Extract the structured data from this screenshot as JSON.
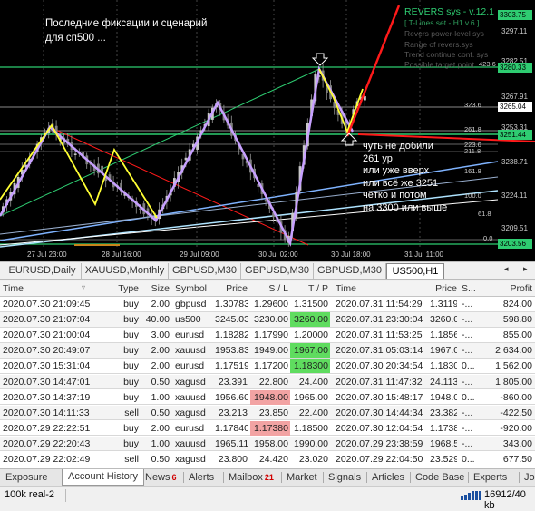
{
  "chart": {
    "annotation_title": "Последние фиксации и сценарий\nдля сп500 ...",
    "annotation_note": "чуть не добили\n261 ур\nили уже вверх\nили всё же 3251\nчётко и потом\nна 3300 или выше",
    "indicator": {
      "title": "REVERS sys - v.12.1",
      "lines": [
        "[ T-Lines set - H1 v.6 ]",
        "Revers power-level sys",
        "Range of revers.sys",
        "Trend continue conf. sys",
        "Possible target point"
      ]
    },
    "price_boxes": [
      {
        "value": "3303.75",
        "color": "#2ecc71"
      },
      {
        "value": "3280.33",
        "color": "#2ecc71"
      },
      {
        "value": "3265.04",
        "color": "#ffffff"
      },
      {
        "value": "3251.44",
        "color": "#2ecc71"
      },
      {
        "value": "3203.56",
        "color": "#2ecc71"
      }
    ],
    "price_axis": [
      "3297.11",
      "3282.51",
      "3267.91",
      "3253.31",
      "3238.71",
      "3224.11",
      "3209.51"
    ],
    "levels": [
      "423.6",
      "323.6",
      "261.8",
      "223.6",
      "211.8",
      "161.8",
      "100.0",
      "61.8",
      "0.0"
    ],
    "time_axis": [
      "27 Jul 23:00",
      "28 Jul 16:00",
      "29 Jul 09:00",
      "30 Jul 02:00",
      "30 Jul 18:00",
      "31 Jul 11:00"
    ],
    "colors": {
      "bull": "#c8c8c8",
      "bear": "#808080",
      "zigzag": "#c7a0ff",
      "wave": "#ffff33",
      "red_line": "#ff1a1a",
      "green_line": "#2ecc71"
    }
  },
  "chart_tabs": [
    "EURUSD,Daily",
    "XAUUSD,Monthly",
    "GBPUSD,M30",
    "GBPUSD,M30",
    "GBPUSD,M30",
    "US500,H1"
  ],
  "history": {
    "headers": [
      "Time",
      "Type",
      "Size",
      "Symbol",
      "Price",
      "S / L",
      "T / P",
      "Time",
      "Price",
      "S...",
      "Profit"
    ],
    "rows": [
      [
        "2020.07.30 21:09:45",
        "buy",
        "2.00",
        "gbpusd",
        "1.30783",
        "1.29600",
        "1.31500",
        "2020.07.31 11:54:29",
        "1.31195",
        "-...",
        "824.00"
      ],
      [
        "2020.07.30 21:07:04",
        "buy",
        "40.00",
        "us500",
        "3245.03",
        "3230.00",
        "3260.00",
        "2020.07.31 23:30:04",
        "3260.00",
        "-...",
        "598.80"
      ],
      [
        "2020.07.30 21:00:04",
        "buy",
        "3.00",
        "eurusd",
        "1.18282",
        "1.17990",
        "1.20000",
        "2020.07.31 11:53:25",
        "1.18567",
        "-...",
        "855.00"
      ],
      [
        "2020.07.30 20:49:07",
        "buy",
        "2.00",
        "xauusd",
        "1953.83",
        "1949.00",
        "1967.00",
        "2020.07.31 05:03:14",
        "1967.00",
        "-...",
        "2 634.00"
      ],
      [
        "2020.07.30 15:31:04",
        "buy",
        "2.00",
        "eurusd",
        "1.17519",
        "1.17200",
        "1.18300",
        "2020.07.30 20:34:54",
        "1.18300",
        "0...",
        "1 562.00"
      ],
      [
        "2020.07.30 14:47:01",
        "buy",
        "0.50",
        "xagusd",
        "23.391",
        "22.800",
        "24.400",
        "2020.07.31 11:47:32",
        "24.113",
        "-...",
        "1 805.00"
      ],
      [
        "2020.07.30 14:37:19",
        "buy",
        "1.00",
        "xauusd",
        "1956.60",
        "1948.00",
        "1965.00",
        "2020.07.30 15:48:17",
        "1948.00",
        "0...",
        "-860.00"
      ],
      [
        "2020.07.30 14:11:33",
        "sell",
        "0.50",
        "xagusd",
        "23.213",
        "23.850",
        "22.400",
        "2020.07.30 14:44:34",
        "23.382",
        "-...",
        "-422.50"
      ],
      [
        "2020.07.29 22:22:51",
        "buy",
        "2.00",
        "eurusd",
        "1.17840",
        "1.17380",
        "1.18500",
        "2020.07.30 12:04:54",
        "1.17380",
        "-...",
        "-920.00"
      ],
      [
        "2020.07.29 22:20:43",
        "buy",
        "1.00",
        "xauusd",
        "1965.11",
        "1958.00",
        "1990.00",
        "2020.07.29 23:38:59",
        "1968.54",
        "-...",
        "343.00"
      ],
      [
        "2020.07.29 22:02:49",
        "sell",
        "0.50",
        "xagusd",
        "23.800",
        "24.420",
        "23.020",
        "2020.07.29 22:04:50",
        "23.529",
        "0...",
        "677.50"
      ]
    ],
    "highlight_tp_rows": [
      1,
      3,
      4
    ],
    "highlight_sl_rows": [
      6,
      8
    ]
  },
  "bottom_tabs": [
    {
      "label": "Exposure",
      "badge": ""
    },
    {
      "label": "Account History",
      "badge": ""
    },
    {
      "label": "News",
      "badge": "6"
    },
    {
      "label": "Alerts",
      "badge": ""
    },
    {
      "label": "Mailbox",
      "badge": "21"
    },
    {
      "label": "Market",
      "badge": ""
    },
    {
      "label": "Signals",
      "badge": ""
    },
    {
      "label": "Articles",
      "badge": ""
    },
    {
      "label": "Code Base",
      "badge": ""
    },
    {
      "label": "Experts",
      "badge": ""
    },
    {
      "label": "Jo",
      "badge": ""
    }
  ],
  "active_bottom_tab": 1,
  "status": {
    "account": "100k real-2",
    "traffic": "16912/40 kb"
  }
}
